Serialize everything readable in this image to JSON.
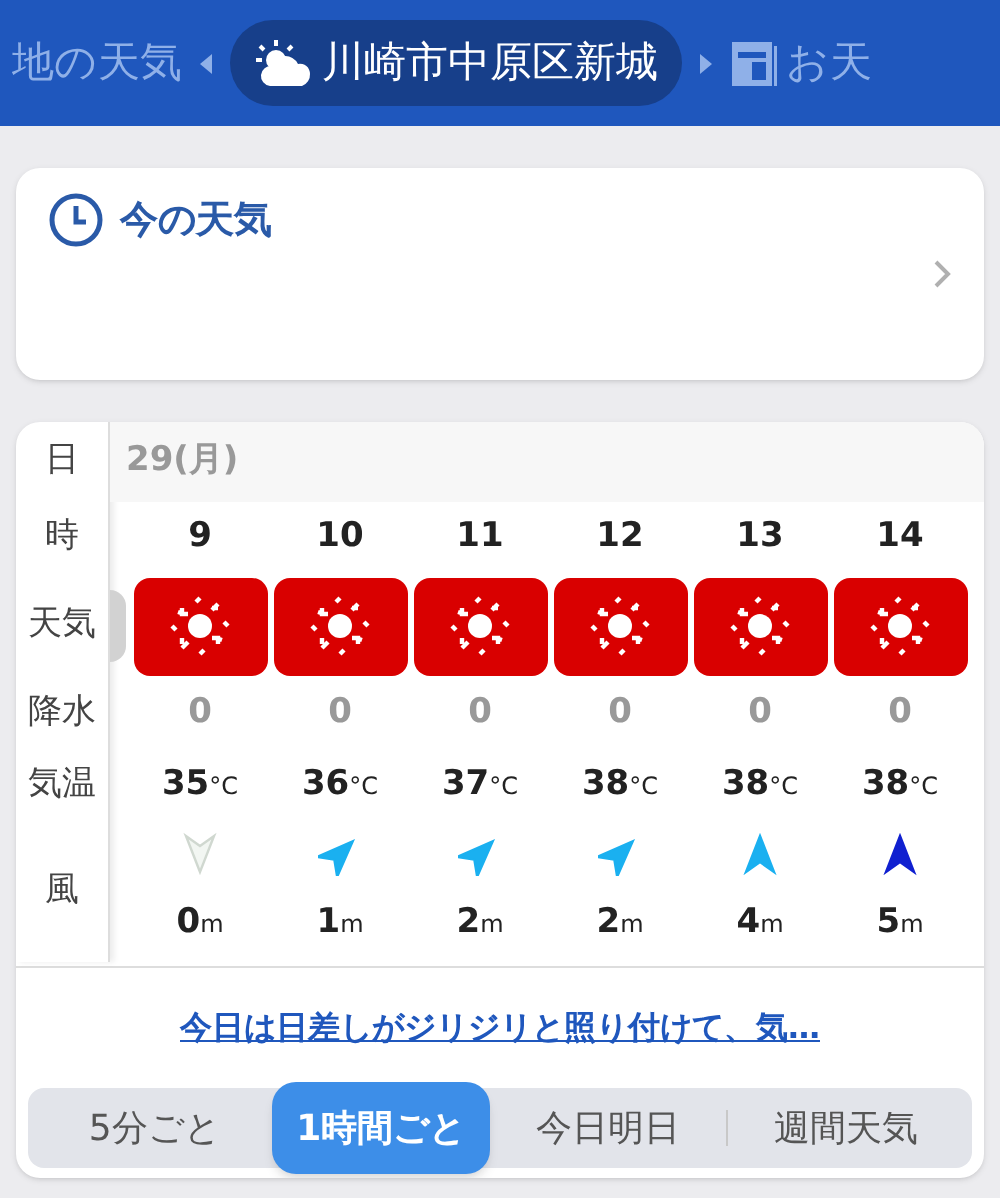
{
  "header": {
    "tabs": [
      {
        "label": "地の天気",
        "selected": false
      },
      {
        "label": "川崎市中原区新城",
        "selected": true
      },
      {
        "label": "お天",
        "selected": false
      }
    ]
  },
  "now_card": {
    "title": "今の天気"
  },
  "forecast": {
    "row_labels": {
      "date": "日",
      "hour": "時",
      "weather": "天気",
      "precip": "降水",
      "temp": "気温",
      "wind": "風"
    },
    "date": "29(月)",
    "hours": [
      {
        "hour": "9",
        "kind": "sunny",
        "precip": "0",
        "temp": "35",
        "temp_unit": "°C",
        "wind_arrow": {
          "kind": "south",
          "color": "#d0d8d0"
        },
        "wind": "0",
        "wind_unit": "m"
      },
      {
        "hour": "10",
        "kind": "sunny",
        "precip": "0",
        "temp": "36",
        "temp_unit": "°C",
        "wind_arrow": {
          "kind": "northeast",
          "color": "#1ab0f0"
        },
        "wind": "1",
        "wind_unit": "m"
      },
      {
        "hour": "11",
        "kind": "sunny",
        "precip": "0",
        "temp": "37",
        "temp_unit": "°C",
        "wind_arrow": {
          "kind": "northeast",
          "color": "#1ab0f0"
        },
        "wind": "2",
        "wind_unit": "m"
      },
      {
        "hour": "12",
        "kind": "sunny",
        "precip": "0",
        "temp": "38",
        "temp_unit": "°C",
        "wind_arrow": {
          "kind": "northeast",
          "color": "#1ab0f0"
        },
        "wind": "2",
        "wind_unit": "m"
      },
      {
        "hour": "13",
        "kind": "sunny",
        "precip": "0",
        "temp": "38",
        "temp_unit": "°C",
        "wind_arrow": {
          "kind": "north",
          "color": "#1ab0f0"
        },
        "wind": "4",
        "wind_unit": "m"
      },
      {
        "hour": "14",
        "kind": "sunny",
        "precip": "0",
        "temp": "38",
        "temp_unit": "°C",
        "wind_arrow": {
          "kind": "north",
          "color": "#1020d0"
        },
        "wind": "5",
        "wind_unit": "m"
      }
    ],
    "comment_link": "今日は日差しがジリジリと照り付けて、気…",
    "segments": [
      {
        "label": "5分ごと",
        "selected": false
      },
      {
        "label": "1時間ごと",
        "selected": true
      },
      {
        "label": "今日明日",
        "selected": false
      },
      {
        "label": "週間天気",
        "selected": false
      }
    ]
  }
}
